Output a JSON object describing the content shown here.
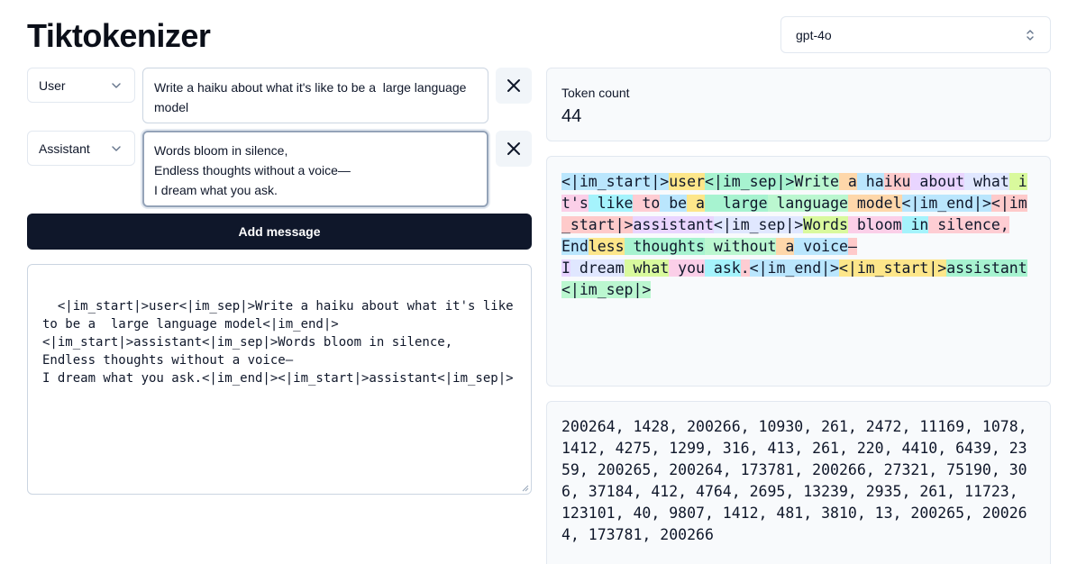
{
  "app": {
    "title": "Tiktokenizer"
  },
  "model_select": {
    "value": "gpt-4o"
  },
  "messages": [
    {
      "role": "User",
      "content": "Write a haiku about what it's like to be a  large language model"
    },
    {
      "role": "Assistant",
      "content": "Words bloom in silence,\nEndless thoughts without a voice—\nI dream what you ask."
    }
  ],
  "add_message_label": "Add message",
  "raw_text": "<|im_start|>user<|im_sep|>Write a haiku about what it's like to be a  large language model<|im_end|>\n<|im_start|>assistant<|im_sep|>Words bloom in silence,\nEndless thoughts without a voice—\nI dream what you ask.<|im_end|><|im_start|>assistant<|im_sep|>",
  "token_count": {
    "label": "Token count",
    "value": "44"
  },
  "tokens": [
    "<|im_start|>",
    "user",
    "<|im_sep|>",
    "Write",
    " a",
    " ha",
    "iku",
    " about",
    " what",
    " i",
    "t's",
    " like",
    " to",
    " be",
    " a",
    "  large",
    " language",
    " model",
    "<|im_end|>",
    "<|im_start|>",
    "assistant",
    "<|im_sep|>",
    "Words",
    " bloom",
    " in",
    " silence,",
    "\nEnd",
    "less",
    " thoughts",
    " without",
    " a",
    " voice",
    "—\n",
    "I",
    " dream",
    " what",
    " you",
    " ask",
    ".",
    "<|im_end|>",
    "<|im_start|>",
    "assistant",
    "<|im_sep|>"
  ],
  "token_colors": [
    "#bae6fd",
    "#fde68a",
    "#a7f3d0",
    "#bbf7d0",
    "#fed7aa",
    "#bae6fd",
    "#fecaca",
    "#e9d5ff",
    "#e0e7ff",
    "#d9f99d",
    "#fbcfe8",
    "#a5f3fc",
    "#fecdd3"
  ],
  "token_ids": "200264, 1428, 200266, 10930, 261, 2472, 11169, 1078, 1412, 4275, 1299, 316, 413, 261, 220, 4410, 6439, 2359, 200265, 200264, 173781, 200266, 27321, 75190, 306, 37184, 412, 4764, 2695, 13239, 2935, 261, 11723, 123101, 40, 9807, 1412, 481, 3810, 13, 200265, 200264, 173781, 200266",
  "icons": {
    "select": "chevron-up-down-icon",
    "role": "chevron-down-icon",
    "close": "x-icon"
  }
}
